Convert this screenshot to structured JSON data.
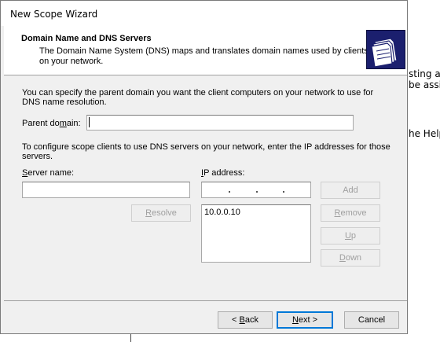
{
  "background": {
    "line1": "sting a",
    "line2": "be assig",
    "line3": "he Help."
  },
  "window": {
    "title": "New Scope Wizard"
  },
  "header": {
    "title": "Domain Name and DNS Servers",
    "description": "The Domain Name System (DNS) maps and translates domain names used by clients on your network.",
    "icon": "folders-icon"
  },
  "content": {
    "intro": "You can specify the parent domain you want the client computers on your network to use for DNS name resolution.",
    "parent_domain": {
      "label_before": "Parent do",
      "label_mnemonic": "m",
      "label_after": "ain:",
      "value": ""
    },
    "dns_instructions": "To configure scope clients to use DNS servers on your network, enter the IP addresses for those servers.",
    "server_name": {
      "label_mnemonic": "S",
      "label_rest": "erver name:",
      "value": ""
    },
    "ip_address": {
      "label_mnemonic": "I",
      "label_rest": "P address:",
      "value": ""
    },
    "buttons": {
      "resolve": {
        "mnemonic": "R",
        "rest": "esolve"
      },
      "add": {
        "mnemonic": "",
        "label": "Add"
      },
      "remove": {
        "mnemonic": "R",
        "rest": "emove"
      },
      "up": {
        "mnemonic": "U",
        "rest": "p"
      },
      "down": {
        "mnemonic": "D",
        "rest": "own"
      }
    },
    "dns_servers": [
      "10.0.0.10"
    ]
  },
  "footer": {
    "back": {
      "prefix": "< ",
      "mnemonic": "B",
      "rest": "ack"
    },
    "next": {
      "mnemonic": "N",
      "rest": "ext >"
    },
    "cancel": "Cancel"
  }
}
